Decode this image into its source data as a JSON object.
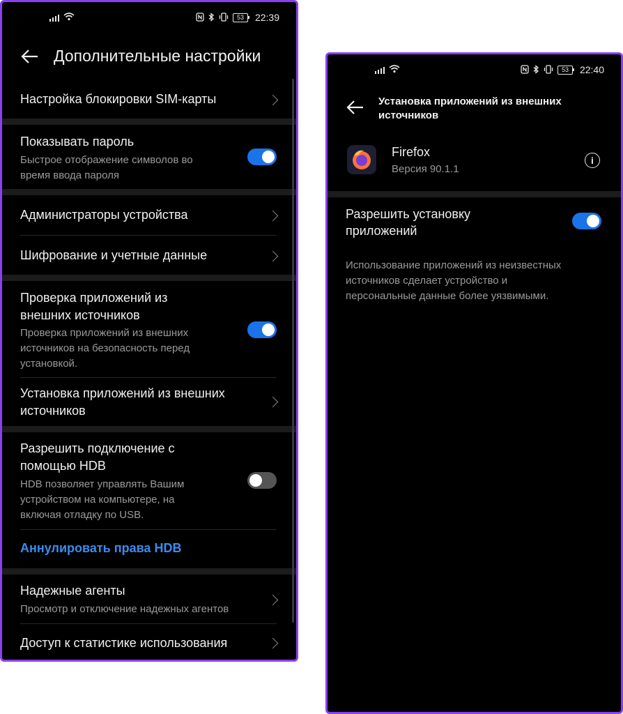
{
  "left": {
    "status": {
      "time": "22:39",
      "battery": "53"
    },
    "header": {
      "title": "Дополнительные настройки"
    },
    "items": [
      {
        "title": "Настройка блокировки SIM-карты"
      },
      {
        "title": "Показывать пароль",
        "subtitle_lines": [
          "Быстрое отображение символов во",
          "время ввода пароля"
        ],
        "toggle": "on"
      },
      {
        "title": "Администраторы устройства"
      },
      {
        "title": "Шифрование и учетные данные"
      },
      {
        "title_lines": [
          "Проверка приложений из",
          "внешних источников"
        ],
        "subtitle_lines": [
          "Проверка приложений из внешних",
          "источников на безопасность перед",
          "установкой."
        ],
        "toggle": "on"
      },
      {
        "title_lines": [
          "Установка приложений из внешних",
          "источников"
        ]
      },
      {
        "title_lines": [
          "Разрешить подключение с",
          "помощью HDB"
        ],
        "subtitle_lines": [
          "HDB позволяет управлять Вашим",
          "устройством на компьютере, на",
          "включая отладку по USB."
        ],
        "toggle": "off"
      },
      {
        "link": "Аннулировать права HDB"
      },
      {
        "title": "Надежные агенты",
        "subtitle": "Просмотр и отключение надежных агентов"
      },
      {
        "title": "Доступ к статистике использования"
      }
    ]
  },
  "right": {
    "status": {
      "time": "22:40",
      "battery": "53"
    },
    "header": {
      "title_lines": [
        "Установка приложений из внешних",
        "источников"
      ]
    },
    "app": {
      "name": "Firefox",
      "version": "Версия 90.1.1"
    },
    "allow": {
      "title_lines": [
        "Разрешить установку",
        "приложений"
      ],
      "toggle": "on"
    },
    "warning_lines": [
      "Использование приложений из неизвестных",
      "источников сделает устройство и",
      "персональные данные более уязвимыми."
    ]
  },
  "colors": {
    "accent": "#1a73e8",
    "link": "#3a8cf0",
    "frame": "#8a3ff0"
  }
}
